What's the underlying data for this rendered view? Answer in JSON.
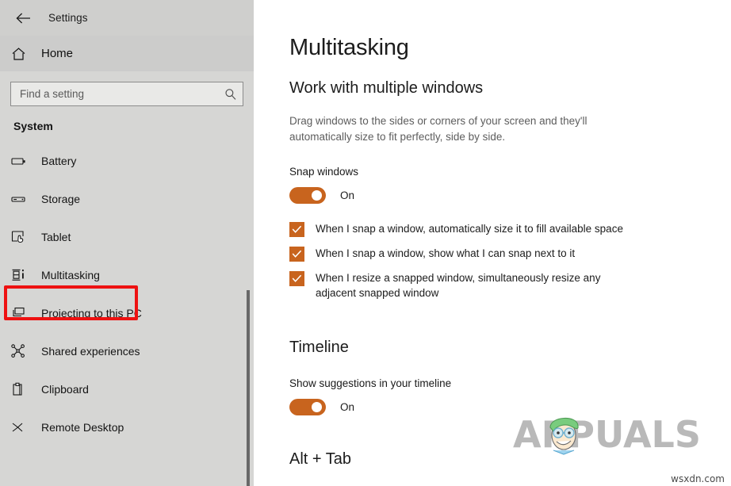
{
  "window": {
    "title": "Settings",
    "back_icon": "back-arrow-icon"
  },
  "sidebar": {
    "home": {
      "label": "Home",
      "icon": "home-icon"
    },
    "search": {
      "placeholder": "Find a setting",
      "value": "",
      "icon": "search-icon"
    },
    "group_title": "System",
    "items": [
      {
        "label": "Battery",
        "icon": "battery-icon",
        "selected": false
      },
      {
        "label": "Storage",
        "icon": "storage-icon",
        "selected": false
      },
      {
        "label": "Tablet",
        "icon": "tablet-icon",
        "selected": false
      },
      {
        "label": "Multitasking",
        "icon": "multitasking-icon",
        "selected": true
      },
      {
        "label": "Projecting to this PC",
        "icon": "projecting-icon",
        "selected": false
      },
      {
        "label": "Shared experiences",
        "icon": "shared-experiences-icon",
        "selected": false
      },
      {
        "label": "Clipboard",
        "icon": "clipboard-icon",
        "selected": false
      },
      {
        "label": "Remote Desktop",
        "icon": "remote-desktop-icon",
        "selected": false
      }
    ]
  },
  "main": {
    "page_title": "Multitasking",
    "section_windows": {
      "heading": "Work with multiple windows",
      "description": "Drag windows to the sides or corners of your screen and they'll automatically size to fit perfectly, side by side.",
      "snap_label": "Snap windows",
      "snap_toggle_state": "On",
      "checkboxes": [
        {
          "label": "When I snap a window, automatically size it to fill available space",
          "checked": true
        },
        {
          "label": "When I snap a window, show what I can snap next to it",
          "checked": true
        },
        {
          "label": "When I resize a snapped window, simultaneously resize any adjacent snapped window",
          "checked": true
        }
      ]
    },
    "section_timeline": {
      "heading": "Timeline",
      "suggestions_label": "Show suggestions in your timeline",
      "suggestions_toggle_state": "On"
    },
    "section_alttab": {
      "heading": "Alt + Tab"
    }
  },
  "watermark": {
    "brand": "APPUALS",
    "corner_url": "wsxdn.com"
  },
  "colors": {
    "accent": "#c8641e",
    "annotation": "#ee1111",
    "sidebar_bg": "#d6d6d4",
    "titlebar_bg": "#cfcfcd"
  }
}
